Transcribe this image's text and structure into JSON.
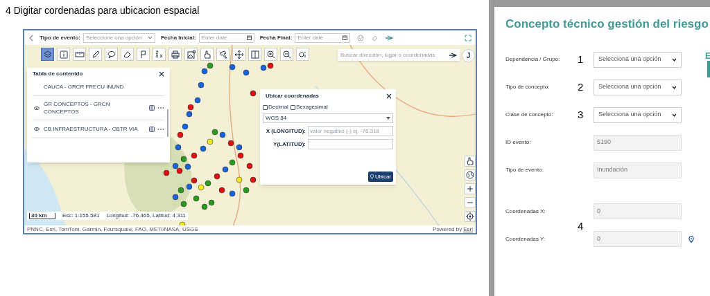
{
  "caption": "4 Digitar cordenadas para ubicacion espacial",
  "map_app": {
    "filters": [
      {
        "label": "Tipo de evento:",
        "kind": "select",
        "placeholder": "Seleccione una opción"
      },
      {
        "label": "Fecha Inicial:",
        "kind": "date",
        "placeholder": "Enter date"
      },
      {
        "label": "Fecha Final:",
        "kind": "date",
        "placeholder": "Enter date"
      }
    ],
    "tools": [
      {
        "selected": true
      },
      {
        "selected": false
      },
      {
        "selected": false
      },
      {
        "selected": false
      },
      {
        "selected": false
      },
      {
        "selected": false
      },
      {
        "selected": false
      },
      {
        "selected": false
      },
      {
        "selected": false
      },
      {
        "selected": false
      },
      {
        "selected": false
      },
      {
        "selected": false
      },
      {
        "selected": false
      },
      {
        "selected": false
      },
      {
        "selected": false
      },
      {
        "selected": false
      },
      {
        "selected": false
      }
    ],
    "search": {
      "placeholder": "Buscar dirección, lugar o coordenadas"
    },
    "user_initial": "J",
    "layers_panel": {
      "title": "Tabla de contenido",
      "items": [
        {
          "label": "CAUCA - GRCR FRECU INUND",
          "kind": "plain"
        },
        {
          "label": "GR CONCEPTOS - GRCN CONCEPTOS",
          "kind": "layer",
          "visible": true
        },
        {
          "label": "CB INFRAESTRUCTURA - CBTR VIA",
          "kind": "layer",
          "visible": true
        }
      ]
    },
    "coords_dialog": {
      "title": "Ubicar coordenadas",
      "options": [
        {
          "label": "Decimal",
          "checked": false
        },
        {
          "label": "Sexagesimal",
          "checked": false
        }
      ],
      "datum": "WGS 84",
      "fields": [
        {
          "label": "X (LONGITUD):",
          "placeholder": "valor negativo (-) ej. -76.318"
        },
        {
          "label": "Y(LATITUD):"
        }
      ],
      "button": "Ubicar"
    },
    "scale_bar": "30 km",
    "scale": "Esc: 1:155.581",
    "position": "Longitud: -76.465, Latitud: 4.311",
    "attribution": "PNNC, Esri, TomTom, Garmin, Foursquare, FAO, METI/NASA, USGS",
    "powered_by": "Powered by",
    "powered_link": "Esri"
  },
  "form": {
    "title": "Concepto técnico gestión del riesgo",
    "side_heading": "E",
    "rows": [
      {
        "label": "Dependencia / Grupo:",
        "kind": "select",
        "value": "Selecciona una opción",
        "annotation": "1"
      },
      {
        "label": "Tipo de concepto:",
        "kind": "select",
        "value": "Selecciona una opción",
        "annotation": "2"
      },
      {
        "label": "Clase de concepto:",
        "kind": "select",
        "value": "Selecciona una opción",
        "annotation": "3"
      },
      {
        "label": "ID evento:",
        "kind": "readonly",
        "value": "5190"
      },
      {
        "label": "Tipo de evento:",
        "kind": "readonly",
        "value": "Inundación"
      }
    ],
    "coordinates": {
      "annotation": "4",
      "rows": [
        {
          "label": "Coordenadas X:",
          "value": "0",
          "pin": false
        },
        {
          "label": "Coordenadas Y:",
          "value": "0",
          "pin": true
        }
      ]
    }
  }
}
